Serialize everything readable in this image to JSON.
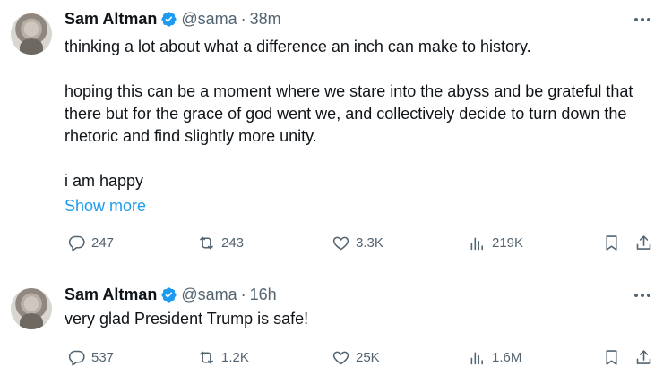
{
  "tweets": [
    {
      "author_name": "Sam Altman",
      "handle": "@sama",
      "separator": "·",
      "time": "38m",
      "paragraphs": [
        "thinking a lot about what a difference an inch can make to history.",
        "hoping this can be a moment where we stare into the abyss and be grateful that there but for the grace of god went we, and collectively decide to turn down the rhetoric and find slightly more unity.",
        "i am happy"
      ],
      "show_more": "Show more",
      "stats": {
        "replies": "247",
        "retweets": "243",
        "likes": "3.3K",
        "views": "219K"
      }
    },
    {
      "author_name": "Sam Altman",
      "handle": "@sama",
      "separator": "·",
      "time": "16h",
      "paragraphs": [
        "very glad President Trump is safe!"
      ],
      "stats": {
        "replies": "537",
        "retweets": "1.2K",
        "likes": "25K",
        "views": "1.6M"
      }
    }
  ],
  "icons": {
    "verified": "verified-badge-icon",
    "more": "more-options-icon",
    "reply": "reply-icon",
    "retweet": "retweet-icon",
    "like": "heart-icon",
    "views": "analytics-icon",
    "bookmark": "bookmark-icon",
    "share": "share-icon"
  },
  "colors": {
    "text": "#0f1419",
    "secondary": "#536471",
    "accent": "#1d9bf0",
    "divider": "#eff3f4"
  }
}
